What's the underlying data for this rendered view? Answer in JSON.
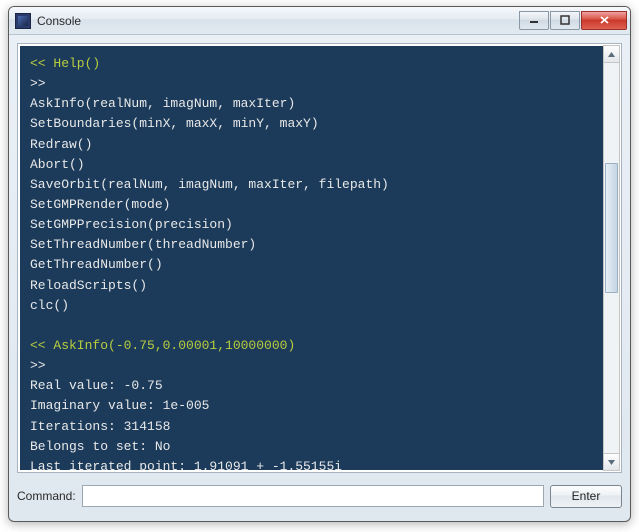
{
  "window": {
    "title": "Console"
  },
  "console": {
    "lines": [
      {
        "type": "prompt",
        "text": "<< Help()"
      },
      {
        "type": "out",
        "text": ">>"
      },
      {
        "type": "out",
        "text": "AskInfo(realNum, imagNum, maxIter)"
      },
      {
        "type": "out",
        "text": "SetBoundaries(minX, maxX, minY, maxY)"
      },
      {
        "type": "out",
        "text": "Redraw()"
      },
      {
        "type": "out",
        "text": "Abort()"
      },
      {
        "type": "out",
        "text": "SaveOrbit(realNum, imagNum, maxIter, filepath)"
      },
      {
        "type": "out",
        "text": "SetGMPRender(mode)"
      },
      {
        "type": "out",
        "text": "SetGMPPrecision(precision)"
      },
      {
        "type": "out",
        "text": "SetThreadNumber(threadNumber)"
      },
      {
        "type": "out",
        "text": "GetThreadNumber()"
      },
      {
        "type": "out",
        "text": "ReloadScripts()"
      },
      {
        "type": "out",
        "text": "clc()"
      },
      {
        "type": "blank",
        "text": ""
      },
      {
        "type": "prompt",
        "text": "<< AskInfo(-0.75,0.00001,10000000)"
      },
      {
        "type": "out",
        "text": ">>"
      },
      {
        "type": "out",
        "text": "Real value: -0.75"
      },
      {
        "type": "out",
        "text": "Imaginary value: 1e-005"
      },
      {
        "type": "out",
        "text": "Iterations: 314158"
      },
      {
        "type": "out",
        "text": "Belongs to set: No"
      },
      {
        "type": "out",
        "text": "Last iterated point: 1.91091 + -1.55155i"
      }
    ]
  },
  "command": {
    "label": "Command:",
    "value": "",
    "placeholder": ""
  },
  "buttons": {
    "enter": "Enter"
  }
}
